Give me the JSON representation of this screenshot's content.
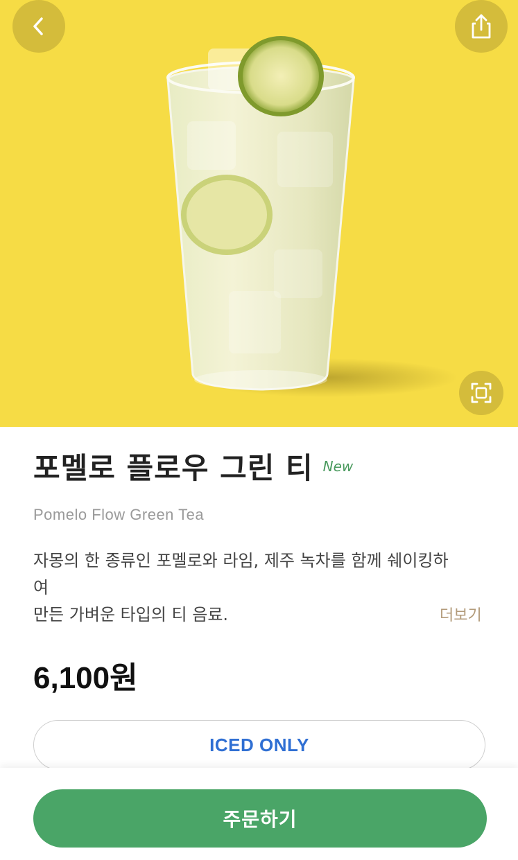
{
  "product": {
    "name_ko": "포멜로 플로우 그린 티",
    "badge": "New",
    "name_en": "Pomelo Flow Green Tea",
    "description_lines": [
      "자몽의 한 종류인 포멜로와 라임, 제주 녹차를 함께 쉐이킹하",
      "여",
      "만든 가벼운 타입의 티 음료."
    ],
    "more_label": "더보기",
    "price": "6,100원",
    "temperature_option": "ICED ONLY"
  },
  "actions": {
    "order_label": "주문하기"
  },
  "colors": {
    "hero_background": "#f6dc45",
    "brand_green": "#4aa567",
    "new_badge": "#4a9a5e",
    "option_text": "#2f6fd3",
    "more_link": "#b29a79"
  },
  "icons": {
    "back": "chevron-left-icon",
    "share": "share-icon",
    "zoom": "expand-icon"
  }
}
